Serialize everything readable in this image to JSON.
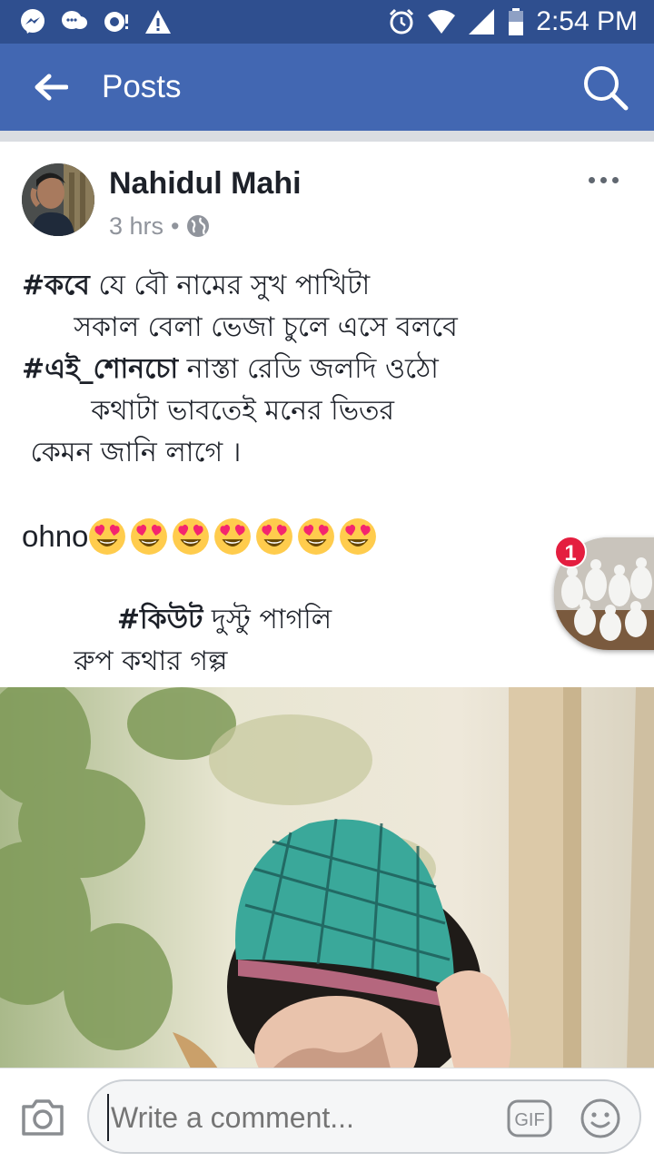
{
  "status_bar": {
    "time": "2:54 PM",
    "left_icons": [
      "messenger-icon",
      "chat-bubbles-icon",
      "notification-icon",
      "warning-icon"
    ],
    "right_icons": [
      "alarm-icon",
      "wifi-icon",
      "signal-icon",
      "battery-icon"
    ]
  },
  "app_bar": {
    "title": "Posts",
    "background": "#4267b2"
  },
  "post": {
    "author": "Nahidul Mahi",
    "time": "3 hrs",
    "separator": "•",
    "privacy_icon": "globe-icon",
    "lines": [
      {
        "tag": "#কবে",
        "text": " যে বৌ নামের সুখ পাখিটা",
        "indent": ""
      },
      {
        "tag": "",
        "text": "সকাল বেলা ভেজা চুলে এসে বলবে",
        "indent": "      "
      },
      {
        "tag": "#এই_শোনচো",
        "text": " নাস্তা রেডি জলদি ওঠো",
        "indent": ""
      },
      {
        "tag": "",
        "text": "কথাটা ভাবতেই মনের ভিতর",
        "indent": "        "
      },
      {
        "tag": "",
        "text": "কেমন জানি লাগে ।",
        "indent": " "
      }
    ],
    "ohno_text": "ohno",
    "emoji_count": 7,
    "emoji_icon": "heart-eyes-emoji",
    "closing": [
      {
        "tag": "#কিউট",
        "text": " দুস্টু পাগলি",
        "indent": "           "
      },
      {
        "tag": "",
        "text": "রুপ কথার গল্প",
        "indent": "      "
      }
    ]
  },
  "chat_head": {
    "badge_count": "1",
    "badge_color": "#e41e3f"
  },
  "comment_bar": {
    "placeholder": "Write a comment...",
    "gif_label": "GIF"
  }
}
